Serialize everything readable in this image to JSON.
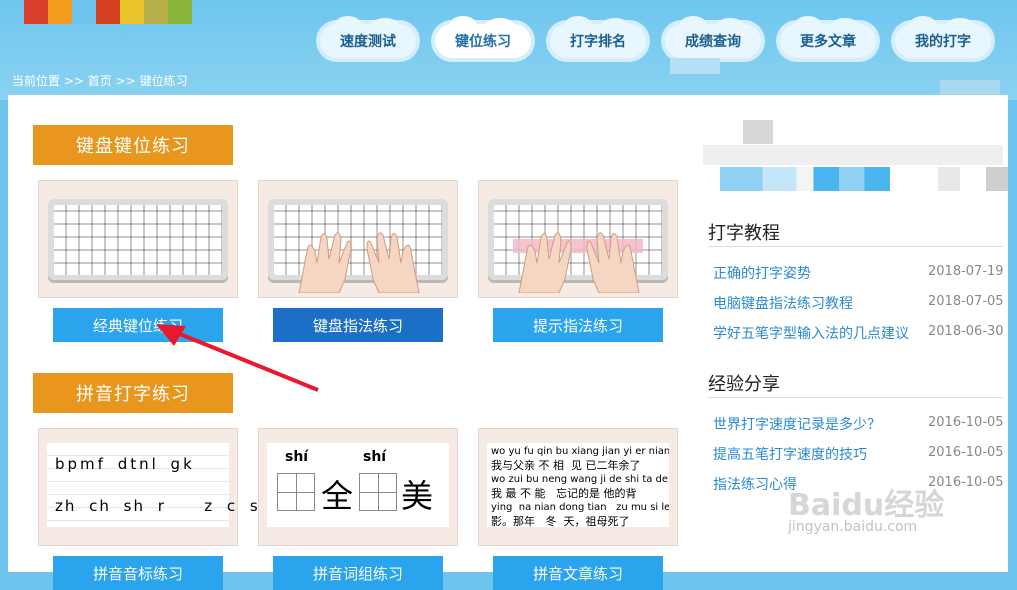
{
  "nav": {
    "items": [
      {
        "label": "速度测试"
      },
      {
        "label": "键位练习",
        "active": true
      },
      {
        "label": "打字排名"
      },
      {
        "label": "成绩查询"
      },
      {
        "label": "更多文章"
      },
      {
        "label": "我的打字"
      }
    ]
  },
  "breadcrumb": {
    "prefix": "当前位置",
    "sep": ">>",
    "home": "首页",
    "current": "键位练习"
  },
  "sections": {
    "keyboard": {
      "title": "键盘键位练习",
      "buttons": [
        "经典键位练习",
        "键盘指法练习",
        "提示指法练习"
      ]
    },
    "pinyin": {
      "title": "拼音打字练习",
      "buttons": [
        "拼音音标练习",
        "拼音词组练习",
        "拼音文章练习"
      ],
      "card1_lines": [
        "bpmf dtnl gk",
        "zh ch sh r   z c s"
      ],
      "card2": {
        "py1": "shí",
        "py2": "shí",
        "ch1": "全",
        "ch2": "美"
      },
      "card3_lines": [
        "wo yu fu qin bu xiang jian yi er nian yu le",
        "我与父亲 不 相  见 已二年余了",
        "wo zui bu neng wang ji de shi ta de bei",
        "我 最 不 能   忘记的是 他的背",
        "ying  na nian dong tian   zu mu si le",
        "影。那年   冬  天，祖母死了"
      ]
    }
  },
  "sidebar": {
    "tutorials": {
      "title": "打字教程",
      "items": [
        {
          "label": "正确的打字姿势",
          "date": "2018-07-19"
        },
        {
          "label": "电脑键盘指法练习教程",
          "date": "2018-07-05"
        },
        {
          "label": "学好五笔字型输入法的几点建议",
          "date": "2018-06-30"
        }
      ]
    },
    "experience": {
      "title": "经验分享",
      "items": [
        {
          "label": "世界打字速度记录是多少？",
          "date": "2016-10-05"
        },
        {
          "label": "提高五笔打字速度的技巧",
          "date": "2016-10-05"
        },
        {
          "label": "指法练习心得",
          "date": "2016-10-05"
        }
      ]
    }
  },
  "watermark": {
    "brand": "Baidu经验",
    "url": "jingyan.baidu.com"
  },
  "colors": {
    "accent_orange": "#e8961e",
    "button_blue": "#2aa4ec",
    "button_dark": "#1c6fc7",
    "arrow": "#e8192c"
  }
}
